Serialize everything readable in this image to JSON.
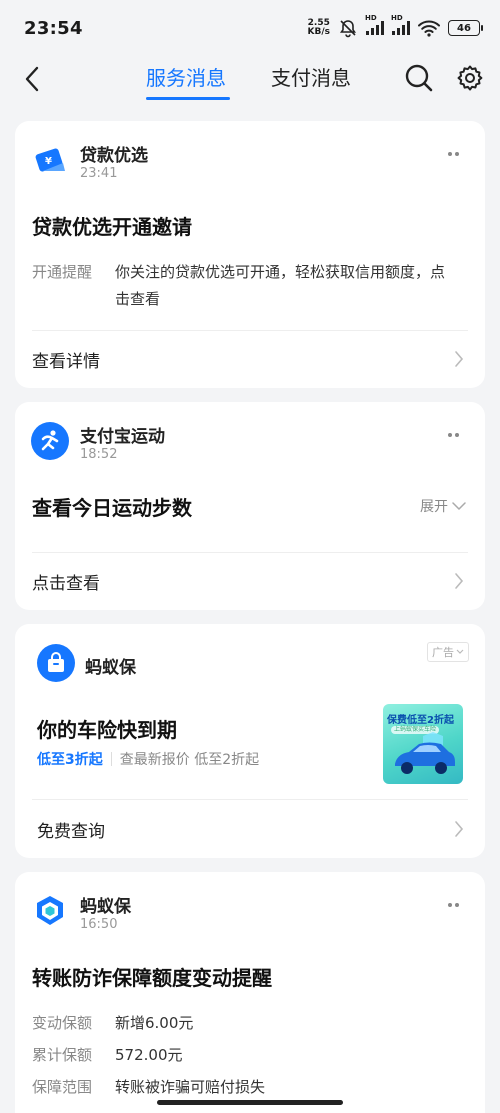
{
  "status_bar": {
    "time": "23:54",
    "speed_value": "2.55",
    "speed_unit": "KB/s",
    "hd": "HD",
    "battery": "46"
  },
  "nav": {
    "tabs": [
      {
        "label": "服务消息",
        "active": true
      },
      {
        "label": "支付消息",
        "active": false
      }
    ]
  },
  "cards": [
    {
      "service": "贷款优选",
      "time": "23:41",
      "title": "贷款优选开通邀请",
      "kv": [
        {
          "k": "开通提醒",
          "v": "你关注的贷款优选可开通，轻松获取信用额度，点击查看"
        }
      ],
      "action": "查看详情"
    },
    {
      "service": "支付宝运动",
      "time": "18:52",
      "title": "查看今日运动步数",
      "expand_label": "展开",
      "action": "点击查看"
    },
    {
      "service": "蚂蚁保",
      "ad_label": "广告",
      "title": "你的车险快到期",
      "highlight": "低至3折起",
      "desc": "查最新报价 低至2折起",
      "thumb_text": "保费低至2折起",
      "thumb_sub": "上蚂蚁保买车险",
      "action": "免费查询"
    },
    {
      "service": "蚂蚁保",
      "time": "16:50",
      "title": "转账防诈保障额度变动提醒",
      "kv": [
        {
          "k": "变动保额",
          "v": "新增6.00元"
        },
        {
          "k": "累计保额",
          "v": "572.00元"
        },
        {
          "k": "保障范围",
          "v": "转账被诈骗可赔付损失"
        }
      ]
    }
  ],
  "colors": {
    "accent": "#1677ff",
    "background": "#f3f4f6",
    "card": "#ffffff"
  }
}
